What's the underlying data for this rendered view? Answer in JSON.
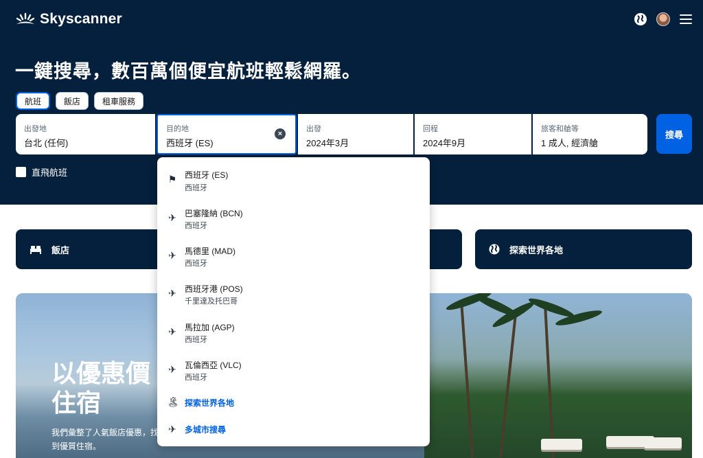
{
  "brand": {
    "name": "Skyscanner"
  },
  "header": {
    "headline": "一鍵搜尋，數百萬個便宜航班輕鬆網羅。",
    "icons": [
      "globe-icon",
      "avatar",
      "menu-icon"
    ]
  },
  "tabs": [
    {
      "label": "航班",
      "active": true
    },
    {
      "label": "飯店",
      "active": false
    },
    {
      "label": "租車服務",
      "active": false
    }
  ],
  "search": {
    "origin_label": "出發地",
    "origin_value": "台北 (任何)",
    "destination_label": "目的地",
    "destination_value": "西班牙 (ES)",
    "depart_label": "出發",
    "depart_value": "2024年3月",
    "return_label": "回程",
    "return_value": "2024年9月",
    "travellers_label": "旅客和艙等",
    "travellers_value": "1 成人, 經濟艙",
    "button": "搜尋",
    "direct_label": "直飛航班",
    "direct_checked": false
  },
  "quick_links": {
    "hotels": "飯店",
    "explore": "探索世界各地"
  },
  "banner": {
    "title": "以優惠價住宿",
    "subtitle": "我們彙整了人氣飯店優惠，找到優質住宿。"
  },
  "dropdown": {
    "options": [
      {
        "title": "西班牙 (ES)",
        "sub": "西班牙",
        "icon": "flag-icon"
      },
      {
        "title": "巴塞隆納 (BCN)",
        "sub": "西班牙",
        "icon": "plane-icon"
      },
      {
        "title": "馬德里 (MAD)",
        "sub": "西班牙",
        "icon": "plane-icon"
      },
      {
        "title": "西班牙港 (POS)",
        "sub": "千里達及托巴哥",
        "icon": "plane-icon"
      },
      {
        "title": "馬拉加 (AGP)",
        "sub": "西班牙",
        "icon": "plane-icon"
      },
      {
        "title": "瓦倫西亞 (VLC)",
        "sub": "西班牙",
        "icon": "plane-icon"
      }
    ],
    "explore_label": "探索世界各地",
    "multicity_label": "多城市搜尋"
  },
  "colors": {
    "navy": "#05203c",
    "primary_blue": "#0062e3",
    "white": "#ffffff"
  }
}
